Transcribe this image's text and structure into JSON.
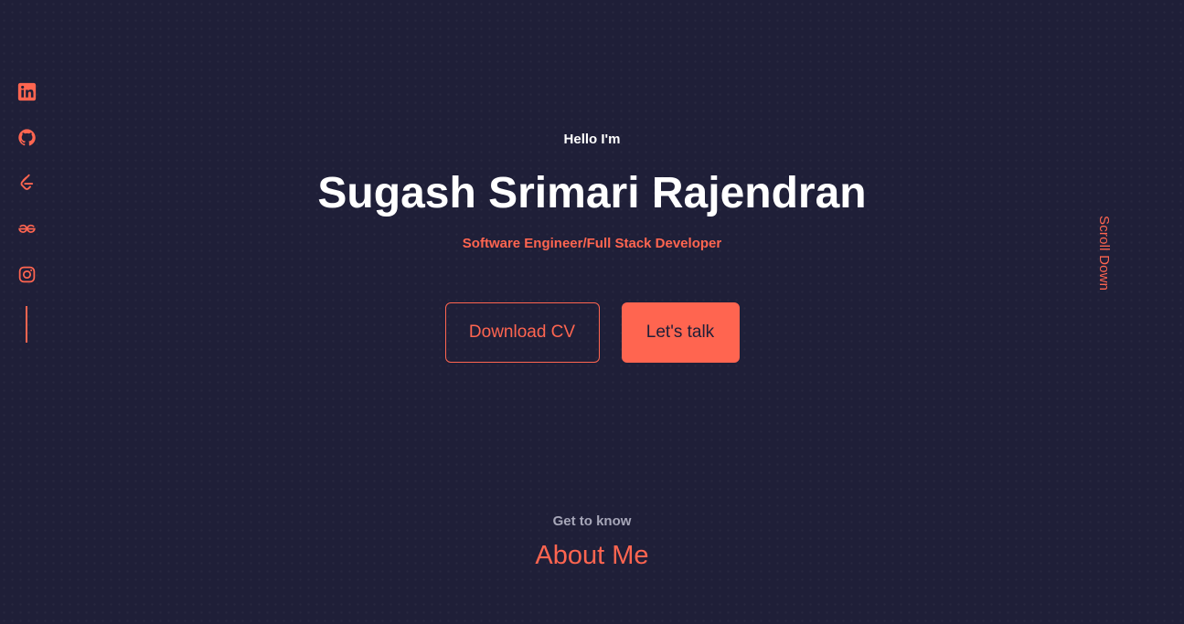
{
  "colors": {
    "background": "#1f1f38",
    "accent": "#ff6550",
    "text": "#ffffff",
    "muted": "#a7a7b9"
  },
  "socials": [
    {
      "icon": "linkedin-icon"
    },
    {
      "icon": "github-icon"
    },
    {
      "icon": "leetcode-icon"
    },
    {
      "icon": "geeksforgeeks-icon"
    },
    {
      "icon": "instagram-icon"
    }
  ],
  "hero": {
    "greeting": "Hello I'm",
    "name": "Sugash Srimari Rajendran",
    "role": "Software Engineer/Full Stack Developer",
    "download_cv_label": "Download CV",
    "lets_talk_label": "Let's talk",
    "scroll_label": "Scroll Down"
  },
  "about": {
    "subtitle": "Get to know",
    "title": "About Me"
  }
}
